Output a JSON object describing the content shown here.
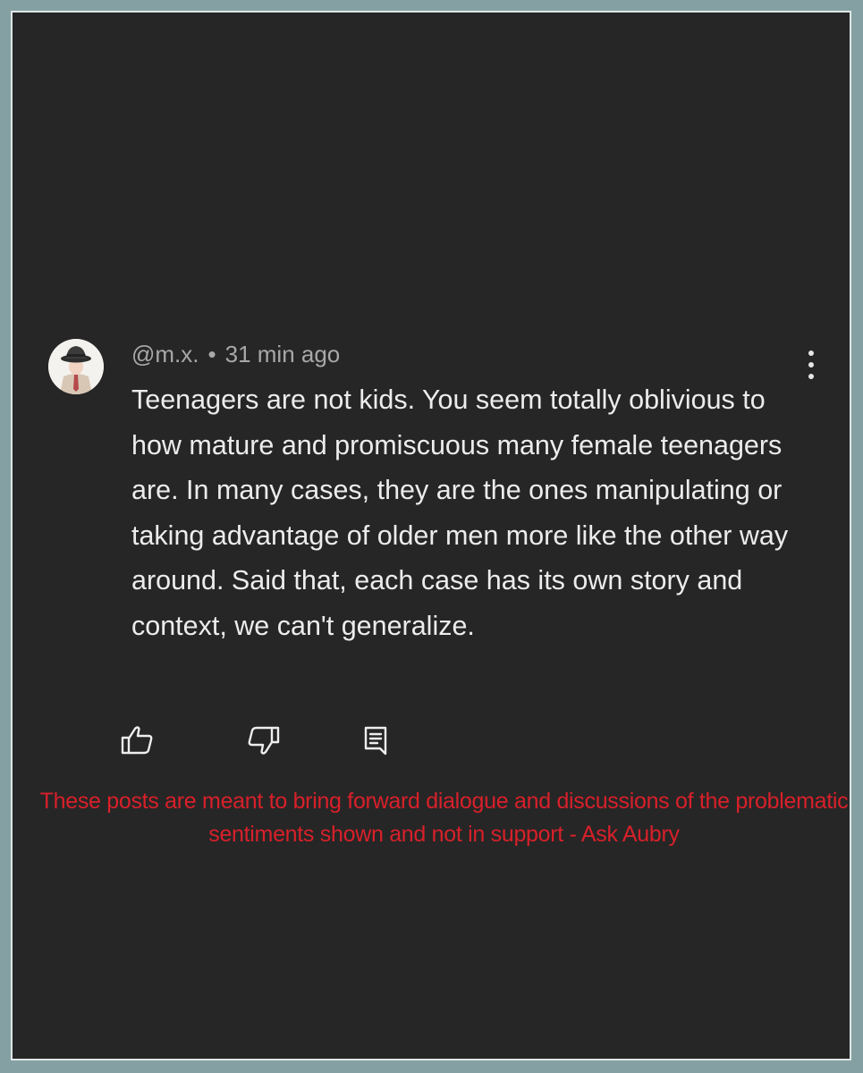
{
  "comment": {
    "username": "@m.x.",
    "separator": "•",
    "timestamp": "31 min ago",
    "text": "Teenagers are not kids. You seem totally oblivious to how mature and promiscuous many female teenagers are. In many cases, they are the ones manipulating or taking advantage of older men more like the other way around. Said that, each case has its own story and context, we can't generalize.",
    "actions": {
      "like_icon": "thumbs-up-icon",
      "dislike_icon": "thumbs-down-icon",
      "reply_icon": "reply-comment-icon",
      "more_icon": "more-vertical-icon"
    }
  },
  "disclaimer": "These posts are meant to bring forward dialogue and discussions of the problematic sentiments shown and not in support - Ask Aubry",
  "colors": {
    "background_frame": "#84a0a2",
    "panel": "#262626",
    "comment_text": "#ececec",
    "meta_text": "#a8a8a8",
    "disclaimer_text": "#d8202a"
  }
}
